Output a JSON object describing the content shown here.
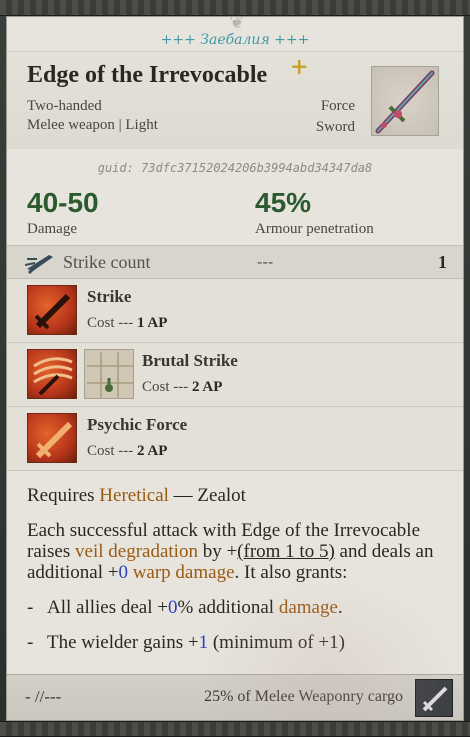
{
  "banner": {
    "text": "+++ Заебалия +++"
  },
  "item": {
    "title": "Edge of the Irrevocable",
    "title_mark": "+",
    "subtitle_1": "Two-handed",
    "subtitle_2": "Melee weapon | Light",
    "category_1": "Force",
    "category_2": "Sword",
    "guid": "guid: 73dfc37152024206b3994abd34347da8"
  },
  "stats": [
    {
      "value": "40-50",
      "label": "Damage"
    },
    {
      "value": "45%",
      "label": "Armour penetration"
    }
  ],
  "strike_count": {
    "label": "Strike count",
    "dash": "---",
    "value": "1"
  },
  "abilities": [
    {
      "name": "Strike",
      "cost_label": "Cost ---",
      "cost_value": "1 AP"
    },
    {
      "name": "Brutal Strike",
      "cost_label": "Cost ---",
      "cost_value": "2 AP"
    },
    {
      "name": "Psychic Force",
      "cost_label": "Cost ---",
      "cost_value": "2 AP"
    }
  ],
  "requirement": {
    "prefix": "Requires",
    "faction": "Heretical",
    "sep": "—",
    "role": "Zealot"
  },
  "description": {
    "p1_a": "Each successful attack with Edge of the Irrevocable raises ",
    "p1_veil": "veil degradation",
    "p1_b": " by +",
    "p1_range": "(from 1 to 5)",
    "p1_c": " and deals an additional +",
    "p1_zero": "0",
    "p1_warp": "warp damage",
    "p1_d": ". It also grants:",
    "li1_bullet": "-",
    "li1_a": "All allies deal +",
    "li1_zero": "0",
    "li1_b": "% additional ",
    "li1_dmg": "damage",
    "li1_c": ".",
    "li2_bullet": "-",
    "li2_a": "The wielder gains +",
    "li2_one": "1",
    "li2_b": " (minimum of +1)"
  },
  "footer": {
    "left": "- //---",
    "right": "25% of Melee Weaponry cargo"
  },
  "colors": {
    "accent_green": "#2a5a2e",
    "highlight": "#9a5a14",
    "value_blue": "#2a3fc4",
    "banner": "#3f9aa5"
  }
}
